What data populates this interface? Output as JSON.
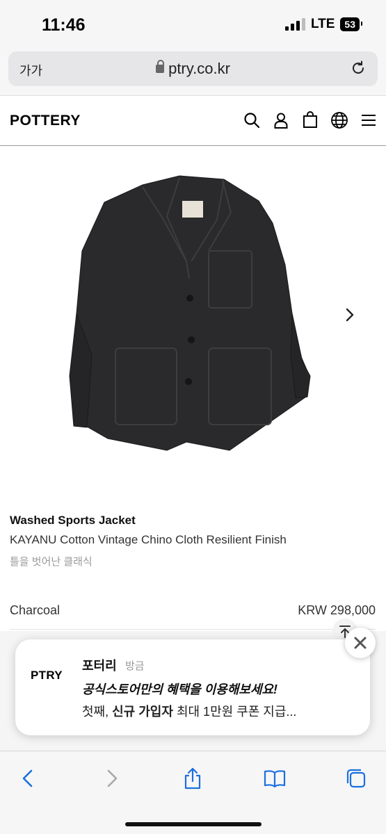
{
  "status_bar": {
    "time": "11:46",
    "network": "LTE",
    "battery": "53"
  },
  "address_bar": {
    "text_size_label": "가가",
    "url": "ptry.co.kr"
  },
  "header": {
    "brand": "POTTERY",
    "icons": [
      "search-icon",
      "user-icon",
      "shopping-bag-icon",
      "globe-icon",
      "menu-icon"
    ]
  },
  "product": {
    "name": "Washed Sports Jacket",
    "subtitle": "KAYANU Cotton Vintage Chino Cloth Resilient Finish",
    "description": "틀을 벗어난 클래식",
    "color": "Charcoal",
    "price": "KRW 298,000",
    "image_color": "#2a2a2c"
  },
  "notification": {
    "logo": "PTRY",
    "app_name": "포터리",
    "time": "방금",
    "title": "공식스토어만의 혜택을 이용해보세요!",
    "body_prefix": "첫째, ",
    "body_bold": "신규 가입자",
    "body_suffix": " 최대 1만원 쿠폰 지급..."
  },
  "toolbar": {
    "icons": [
      "back-icon",
      "forward-icon",
      "share-icon",
      "bookmarks-icon",
      "tabs-icon"
    ],
    "accent": "#1a6fe0"
  }
}
